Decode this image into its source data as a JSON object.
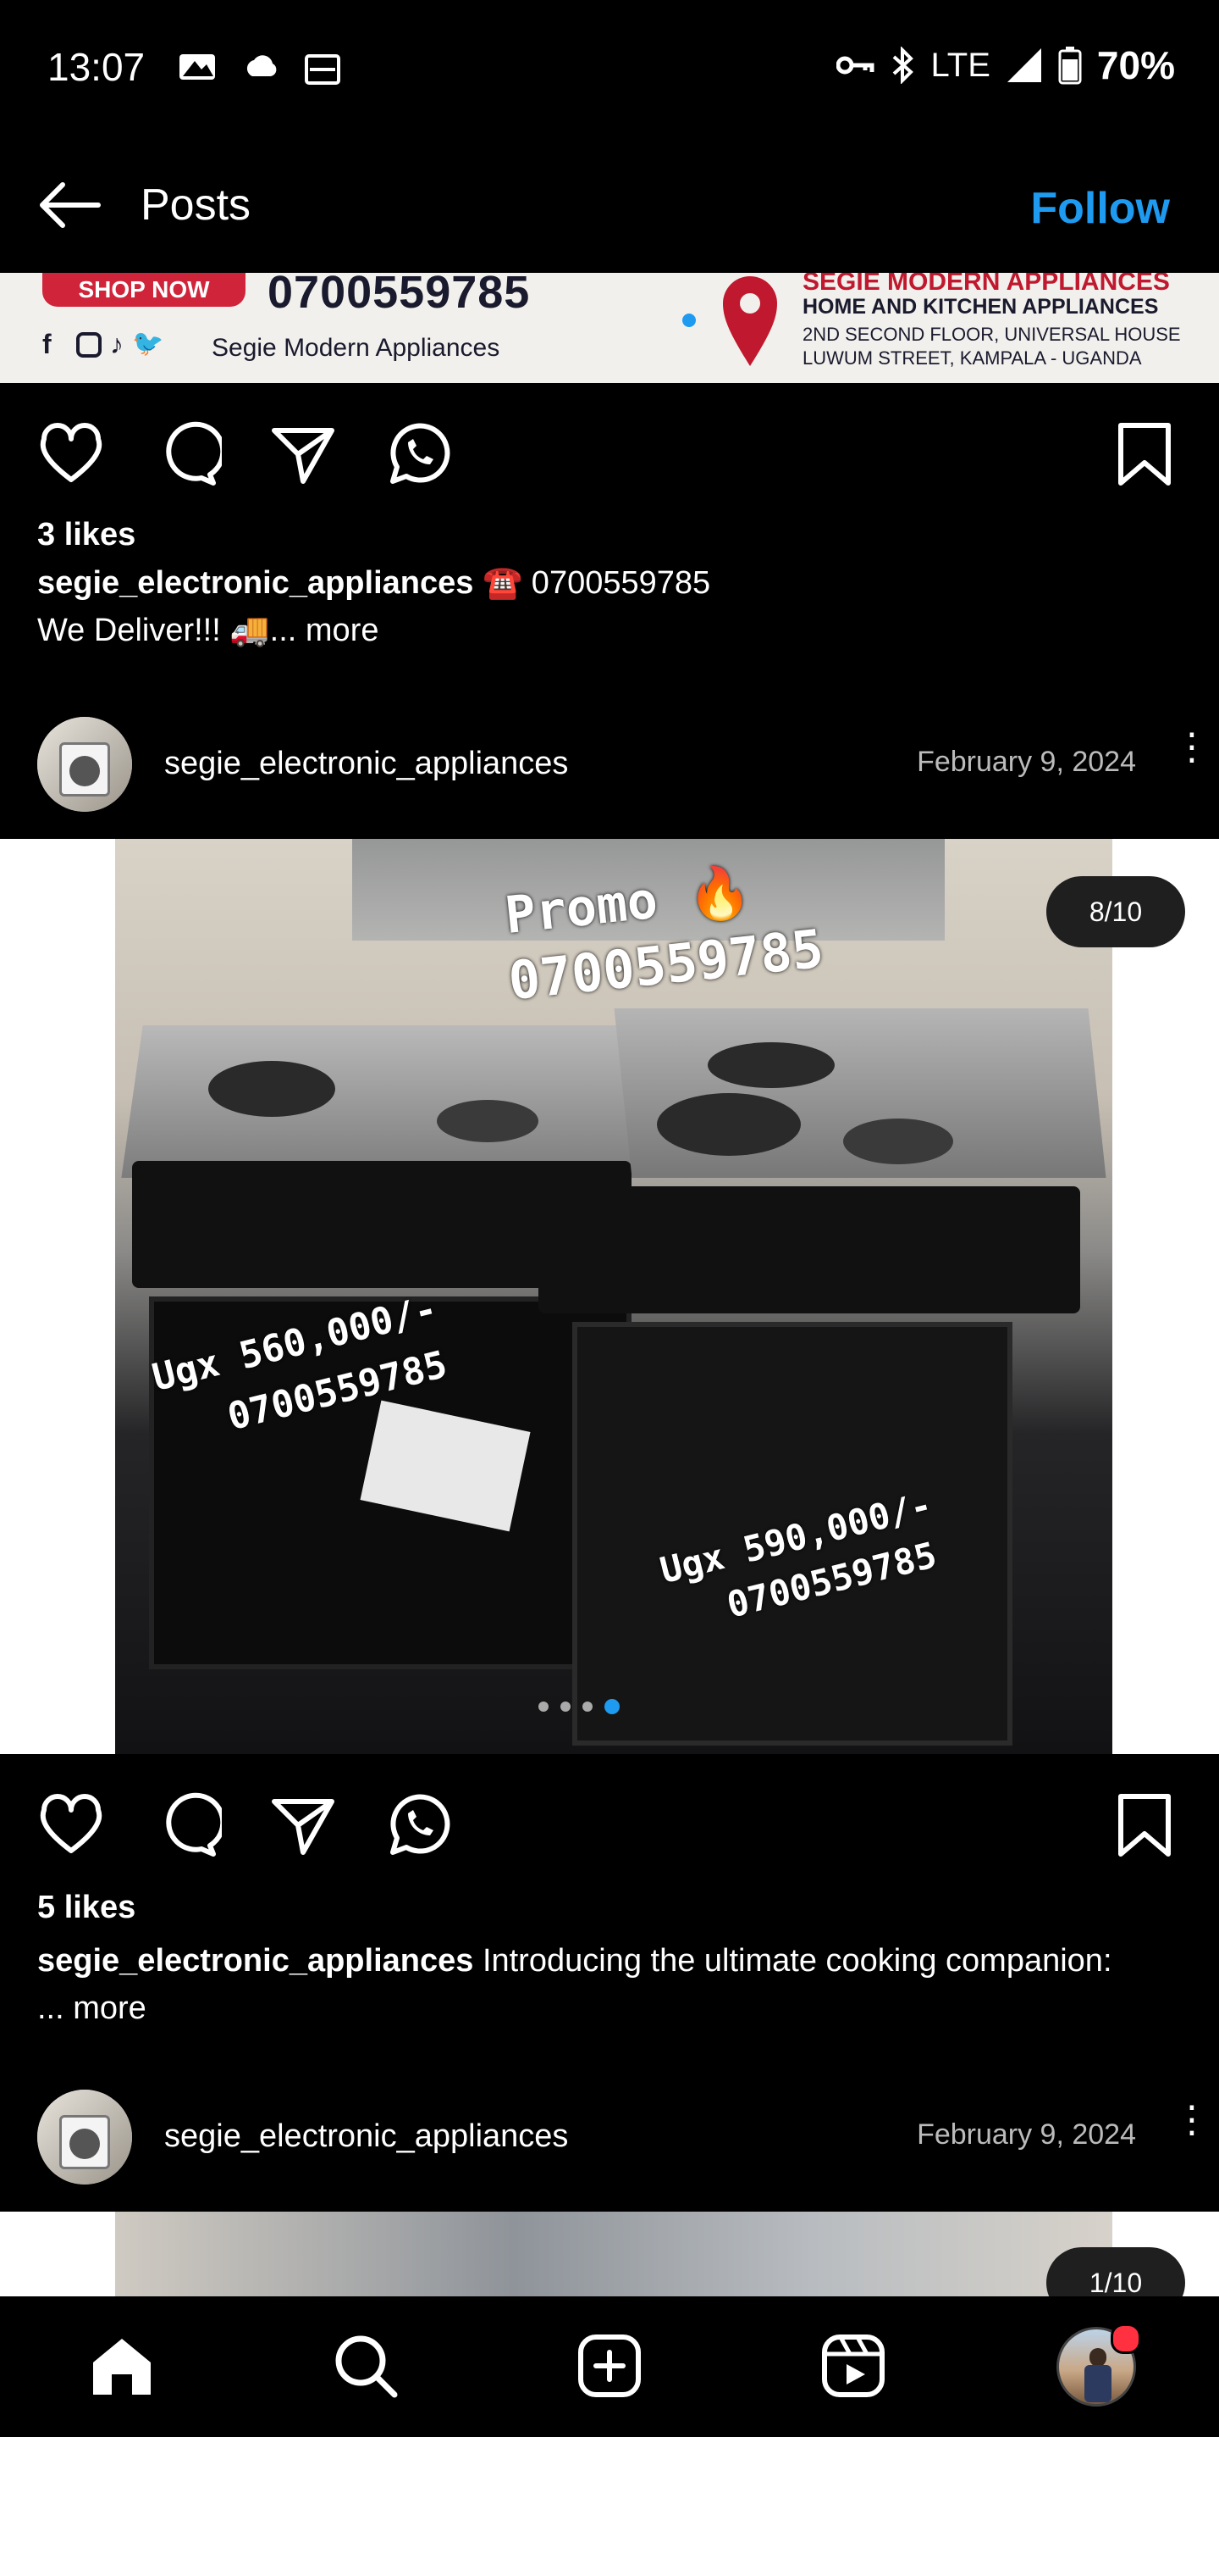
{
  "status_bar": {
    "time": "13:07",
    "network": "LTE",
    "battery": "70%"
  },
  "header": {
    "title": "Posts",
    "follow_label": "Follow"
  },
  "banner": {
    "shop_now": "SHOP NOW",
    "phone": "0700559785",
    "brand_small": "Segie Modern Appliances",
    "brand_big": "SEGIE MODERN APPLIANCES",
    "tagline": "HOME AND KITCHEN APPLIANCES",
    "address1": "2ND SECOND FLOOR, UNIVERSAL HOUSE",
    "address2": "LUWUM STREET, KAMPALA - UGANDA"
  },
  "post1": {
    "likes": "3 likes",
    "username": "segie_electronic_appliances",
    "caption": "☎️ 0700559785",
    "caption2": "We Deliver!!! 🚚",
    "more": "... more"
  },
  "post2": {
    "username": "segie_electronic_appliances",
    "date": "February 9, 2024",
    "counter": "8/10",
    "overlay_promo": "Promo 🔥",
    "overlay_phone": "0700559785",
    "overlay_price1": "Ugx 560,000/-",
    "overlay_phone1": "0700559785",
    "overlay_price2": "Ugx 590,000/-",
    "overlay_phone2": "0700559785",
    "likes": "5 likes",
    "caption": "Introducing the ultimate cooking companion:",
    "more": "... more"
  },
  "post3": {
    "username": "segie_electronic_appliances",
    "date": "February 9, 2024",
    "counter": "1/10"
  },
  "colors": {
    "accent": "#1e9bf0",
    "background": "#000000",
    "notification": "#ff3040"
  },
  "icons": [
    "back-arrow-icon",
    "heart-icon",
    "comment-icon",
    "share-icon",
    "whatsapp-icon",
    "bookmark-icon",
    "more-icon",
    "home-icon",
    "search-icon",
    "create-icon",
    "reels-icon",
    "profile-icon"
  ]
}
